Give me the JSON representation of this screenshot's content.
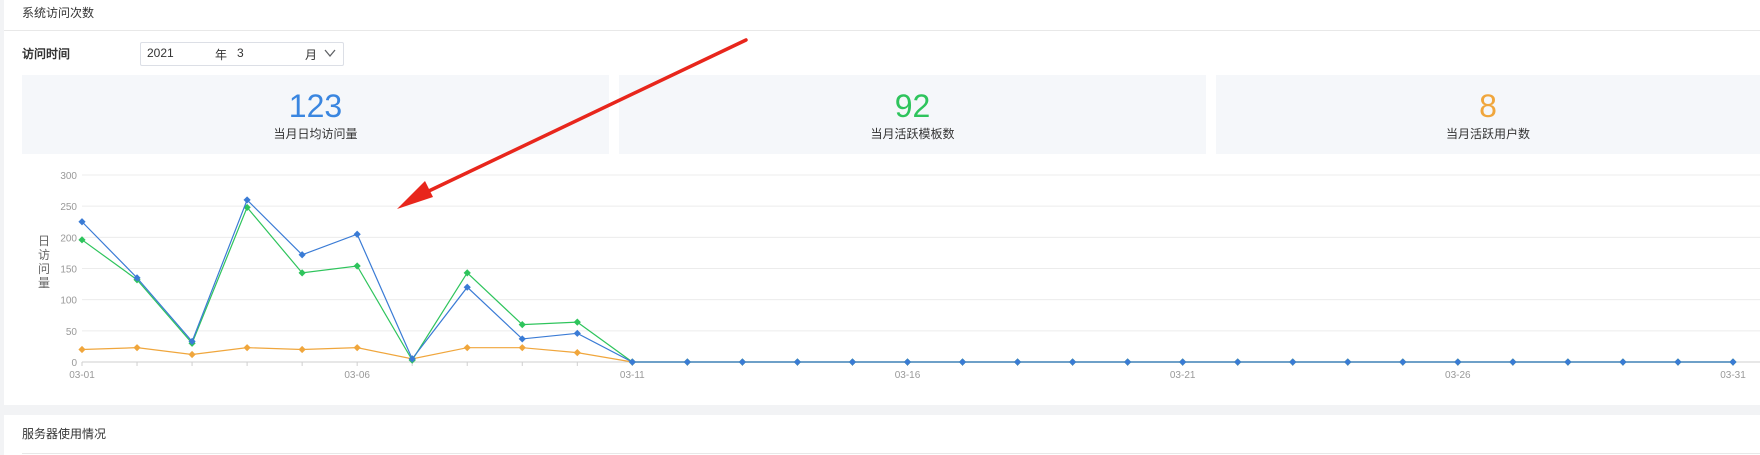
{
  "section": {
    "title": "系统访问次数"
  },
  "filter": {
    "label": "访问时间",
    "year": "2021",
    "year_unit": "年",
    "month": "3",
    "month_unit": "月"
  },
  "stats": [
    {
      "value": "123",
      "label": "当月日均访问量",
      "color": "#3a86e0"
    },
    {
      "value": "92",
      "label": "当月活跃模板数",
      "color": "#2ec45c"
    },
    {
      "value": "8",
      "label": "当月活跃用户数",
      "color": "#f0a63c"
    }
  ],
  "chart_data": {
    "type": "line",
    "ylabel": "日访问量",
    "ylim": [
      0,
      300
    ],
    "yticks": [
      0,
      50,
      100,
      150,
      200,
      250,
      300
    ],
    "x": [
      "03-01",
      "03-02",
      "03-03",
      "03-04",
      "03-05",
      "03-06",
      "03-07",
      "03-08",
      "03-09",
      "03-10",
      "03-11",
      "03-12",
      "03-13",
      "03-14",
      "03-15",
      "03-16",
      "03-17",
      "03-18",
      "03-19",
      "03-20",
      "03-21",
      "03-22",
      "03-23",
      "03-24",
      "03-25",
      "03-26",
      "03-27",
      "03-28",
      "03-29",
      "03-30",
      "03-31"
    ],
    "xtick_labels": [
      "03-01",
      "03-06",
      "03-11",
      "03-16",
      "03-21",
      "03-26",
      "03-31"
    ],
    "grid": true,
    "series": [
      {
        "color": "#3a7bd5",
        "values": [
          225,
          135,
          33,
          260,
          172,
          205,
          5,
          120,
          37,
          46,
          0,
          0,
          0,
          0,
          0,
          0,
          0,
          0,
          0,
          0,
          0,
          0,
          0,
          0,
          0,
          0,
          0,
          0,
          0,
          0,
          0
        ]
      },
      {
        "color": "#2ec45c",
        "values": [
          196,
          132,
          30,
          248,
          143,
          154,
          3,
          143,
          60,
          64,
          0,
          0,
          0,
          0,
          0,
          0,
          0,
          0,
          0,
          0,
          0,
          0,
          0,
          0,
          0,
          0,
          0,
          0,
          0,
          0,
          0
        ]
      },
      {
        "color": "#f0a63c",
        "values": [
          20,
          23,
          12,
          23,
          20,
          23,
          5,
          23,
          23,
          15,
          0,
          0,
          0,
          0,
          0,
          0,
          0,
          0,
          0,
          0,
          0,
          0,
          0,
          0,
          0,
          0,
          0,
          0,
          0,
          0,
          0
        ]
      }
    ]
  },
  "bottom": {
    "title": "服务器使用情况"
  }
}
